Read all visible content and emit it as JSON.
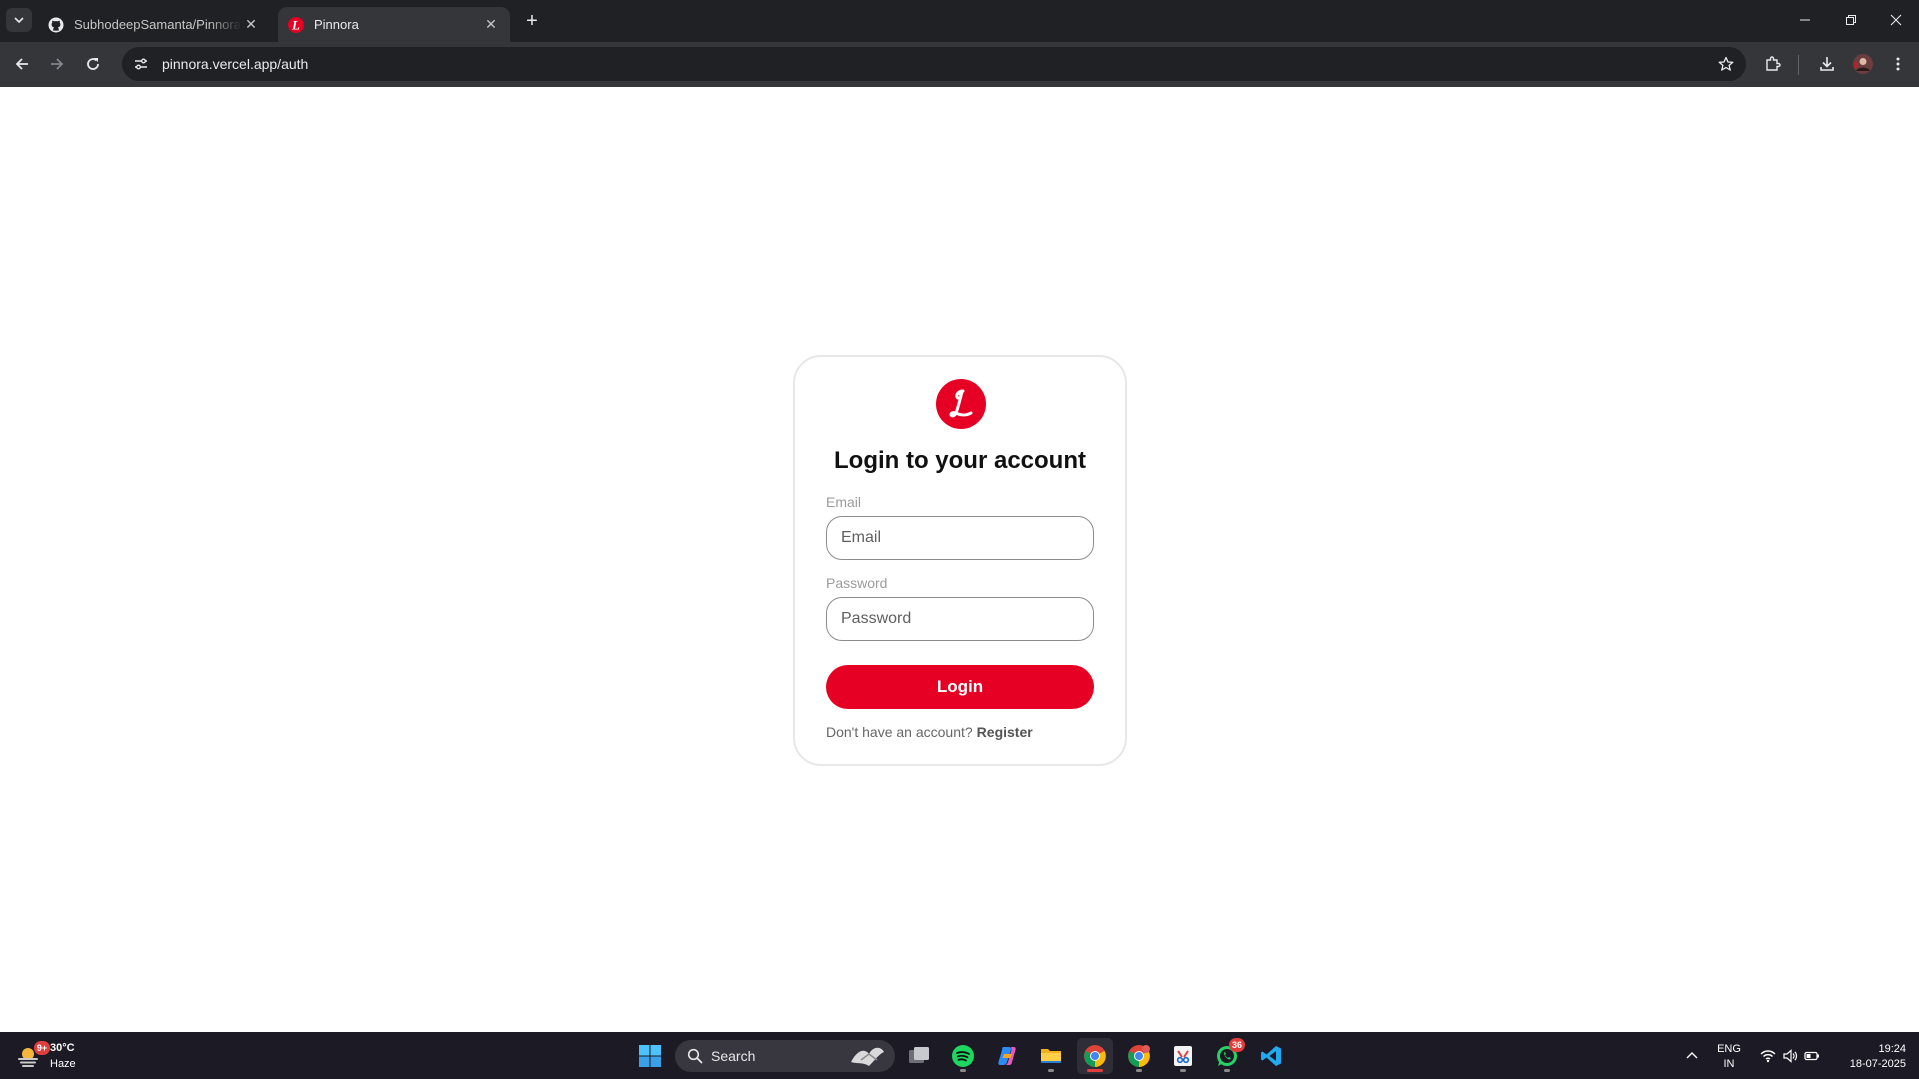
{
  "browser": {
    "tabs": [
      {
        "title": "SubhodeepSamanta/Pinnora: P",
        "icon": "github-icon",
        "active": false
      },
      {
        "title": "Pinnora",
        "icon": "pinnora-logo-icon",
        "active": true
      }
    ],
    "url": "pinnora.vercel.app/auth"
  },
  "auth": {
    "heading": "Login to your account",
    "email_label": "Email",
    "email_placeholder": "Email",
    "email_value": "",
    "password_label": "Password",
    "password_placeholder": "Password",
    "password_value": "",
    "login_label": "Login",
    "register_prompt": "Don't have an account?",
    "register_link": "Register"
  },
  "taskbar": {
    "weather_temp": "30°C",
    "weather_condition": "Haze",
    "weather_badge": "9+",
    "search_label": "Search",
    "apps": [
      "windows-start-icon",
      "task-view-icon",
      "spotify-icon",
      "copilot-icon",
      "file-explorer-icon",
      "chrome-icon",
      "chrome-profile-icon",
      "snipping-tool-icon",
      "whatsapp-icon",
      "vscode-icon"
    ],
    "whatsapp_badge": "36",
    "lang_line1": "ENG",
    "lang_line2": "IN",
    "time": "19:24",
    "date": "18-07-2025"
  },
  "colors": {
    "brand": "#e60023",
    "chrome_dark": "#202124",
    "chrome_toolbar": "#35363a",
    "taskbar": "#1c1a24"
  }
}
